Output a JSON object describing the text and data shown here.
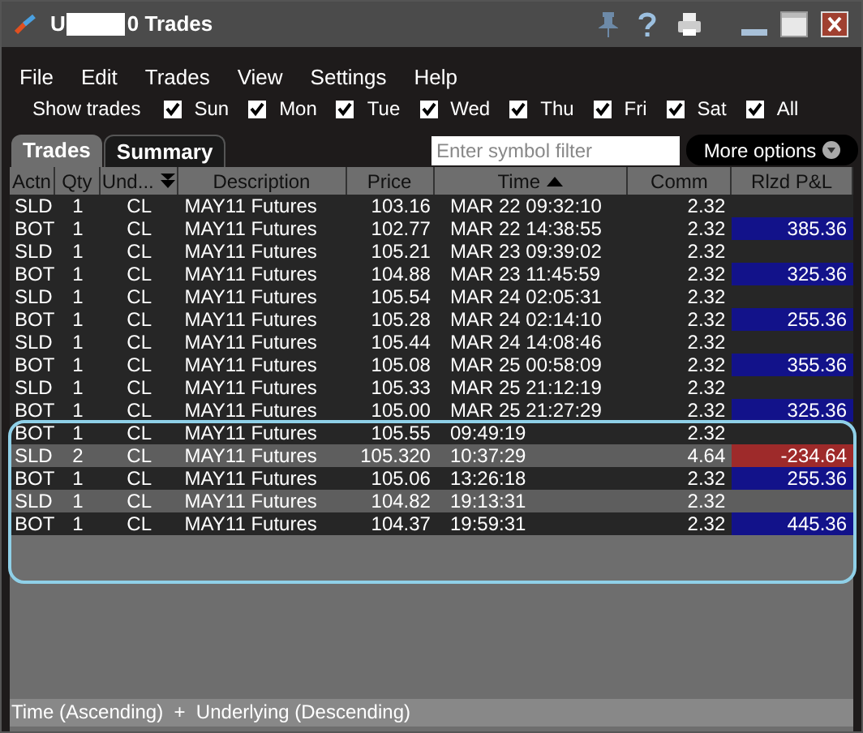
{
  "window": {
    "title_start": "U",
    "title_end": "0 Trades"
  },
  "menu": [
    {
      "label": "File"
    },
    {
      "label": "Edit"
    },
    {
      "label": "Trades"
    },
    {
      "label": "View"
    },
    {
      "label": "Settings"
    },
    {
      "label": "Help"
    }
  ],
  "show_trades": {
    "label": "Show trades",
    "days": [
      {
        "label": "Sun",
        "checked": true
      },
      {
        "label": "Mon",
        "checked": true
      },
      {
        "label": "Tue",
        "checked": true
      },
      {
        "label": "Wed",
        "checked": true
      },
      {
        "label": "Thu",
        "checked": true
      },
      {
        "label": "Fri",
        "checked": true
      },
      {
        "label": "Sat",
        "checked": true
      },
      {
        "label": "All",
        "checked": true
      }
    ]
  },
  "tabs": [
    {
      "label": "Trades",
      "selected": true
    },
    {
      "label": "Summary",
      "selected": false
    }
  ],
  "search": {
    "placeholder": "Enter symbol filter"
  },
  "more_options": {
    "label": "More options"
  },
  "table": {
    "columns": [
      {
        "label": "Actn",
        "kind": "plain"
      },
      {
        "label": "Qty",
        "kind": "plain"
      },
      {
        "label": "Und...",
        "kind": "descending"
      },
      {
        "label": "Description",
        "kind": "plain"
      },
      {
        "label": "Price",
        "kind": "plain"
      },
      {
        "label": "Time",
        "kind": "ascending"
      },
      {
        "label": "Comm",
        "kind": "plain"
      },
      {
        "label": "Rlzd P&L",
        "kind": "plain"
      }
    ],
    "rows": [
      {
        "cells": [
          "SLD",
          "1",
          "CL",
          "MAY11 Futures",
          "103.16",
          "MAR 22 09:32:10",
          "2.32"
        ],
        "shaded": false
      },
      {
        "cells": [
          "BOT",
          "1",
          "CL",
          "MAY11 Futures",
          "102.77",
          "MAR 22 14:38:55",
          "2.32"
        ],
        "shaded": false,
        "pnl": {
          "value": "385.36",
          "color": "#12128a"
        }
      },
      {
        "cells": [
          "SLD",
          "1",
          "CL",
          "MAY11 Futures",
          "105.21",
          "MAR 23 09:39:02",
          "2.32"
        ],
        "shaded": false
      },
      {
        "cells": [
          "BOT",
          "1",
          "CL",
          "MAY11 Futures",
          "104.88",
          "MAR 23 11:45:59",
          "2.32"
        ],
        "shaded": false,
        "pnl": {
          "value": "325.36",
          "color": "#12128a"
        }
      },
      {
        "cells": [
          "SLD",
          "1",
          "CL",
          "MAY11 Futures",
          "105.54",
          "MAR 24 02:05:31",
          "2.32"
        ],
        "shaded": false
      },
      {
        "cells": [
          "BOT",
          "1",
          "CL",
          "MAY11 Futures",
          "105.28",
          "MAR 24 02:14:10",
          "2.32"
        ],
        "shaded": false,
        "pnl": {
          "value": "255.36",
          "color": "#12128a"
        }
      },
      {
        "cells": [
          "SLD",
          "1",
          "CL",
          "MAY11 Futures",
          "105.44",
          "MAR 24 14:08:46",
          "2.32"
        ],
        "shaded": false
      },
      {
        "cells": [
          "BOT",
          "1",
          "CL",
          "MAY11 Futures",
          "105.08",
          "MAR 25 00:58:09",
          "2.32"
        ],
        "shaded": false,
        "pnl": {
          "value": "355.36",
          "color": "#12128a"
        }
      },
      {
        "cells": [
          "SLD",
          "1",
          "CL",
          "MAY11 Futures",
          "105.33",
          "MAR 25 21:12:19",
          "2.32"
        ],
        "shaded": false
      },
      {
        "cells": [
          "BOT",
          "1",
          "CL",
          "MAY11 Futures",
          "105.00",
          "MAR 25 21:27:29",
          "2.32"
        ],
        "shaded": false,
        "pnl": {
          "value": "325.36",
          "color": "#12128a"
        }
      },
      {
        "cells": [
          "BOT",
          "1",
          "CL",
          "MAY11 Futures",
          "105.55",
          "09:49:19",
          "2.32"
        ],
        "shaded": false
      },
      {
        "cells": [
          "SLD",
          "2",
          "CL",
          "MAY11 Futures",
          "105.320",
          "10:37:29",
          "4.64"
        ],
        "shaded": true,
        "pnl": {
          "value": "-234.64",
          "color": "#9e2a2a"
        }
      },
      {
        "cells": [
          "BOT",
          "1",
          "CL",
          "MAY11 Futures",
          "105.06",
          "13:26:18",
          "2.32"
        ],
        "shaded": false,
        "pnl": {
          "value": "255.36",
          "color": "#12128a"
        }
      },
      {
        "cells": [
          "SLD",
          "1",
          "CL",
          "MAY11 Futures",
          "104.82",
          "19:13:31",
          "2.32"
        ],
        "shaded": true
      },
      {
        "cells": [
          "BOT",
          "1",
          "CL",
          "MAY11 Futures",
          "104.37",
          "19:59:31",
          "2.32"
        ],
        "shaded": false,
        "pnl": {
          "value": "445.36",
          "color": "#12128a"
        }
      }
    ]
  },
  "status_bar": {
    "text": "Time (Ascending)  +  Underlying (Descending)"
  }
}
